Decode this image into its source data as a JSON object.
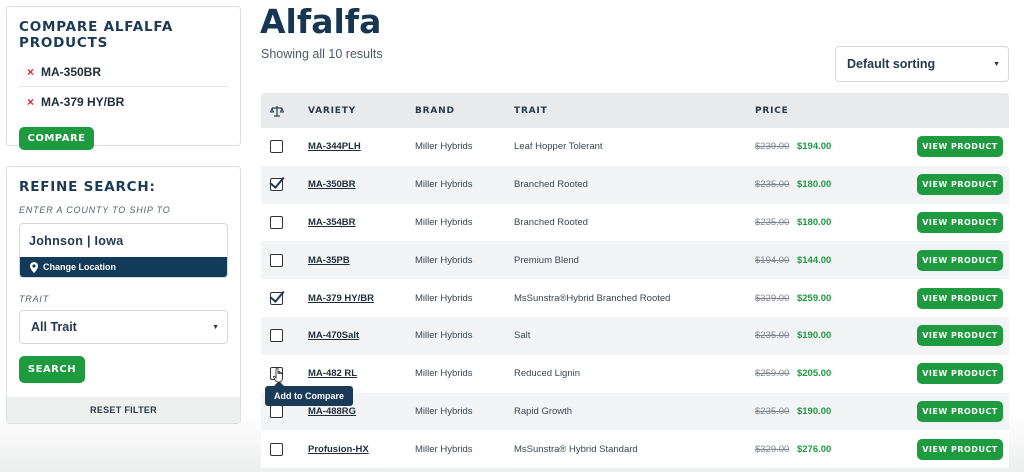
{
  "compare": {
    "title": "COMPARE ALFALFA PRODUCTS",
    "items": [
      "MA-350BR",
      "MA-379 HY/BR"
    ],
    "remove_glyph": "×",
    "button_label": "COMPARE"
  },
  "refine": {
    "title": "REFINE SEARCH:",
    "county_label": "ENTER A COUNTY TO SHIP TO",
    "county_value": "Johnson | Iowa",
    "change_location": "Change Location",
    "trait_label": "TRAIT",
    "trait_value": "All Trait",
    "search_label": "SEARCH",
    "reset_label": "RESET FILTER"
  },
  "main": {
    "title": "Alfalfa",
    "result_count": "Showing all 10 results",
    "sort_value": "Default sorting"
  },
  "table": {
    "headers": {
      "variety": "VARIETY",
      "brand": "BRAND",
      "trait": "TRAIT",
      "price": "PRICE"
    },
    "action_label": "VIEW PRODUCT",
    "rows": [
      {
        "variety": "MA-344PLH",
        "brand": "Miller Hybrids",
        "trait": "Leaf Hopper Tolerant",
        "old_price": "$239.00",
        "new_price": "$194.00",
        "checked": false
      },
      {
        "variety": "MA-350BR",
        "brand": "Miller Hybrids",
        "trait": "Branched Rooted",
        "old_price": "$235.00",
        "new_price": "$180.00",
        "checked": true
      },
      {
        "variety": "MA-354BR",
        "brand": "Miller Hybrids",
        "trait": "Branched Rooted",
        "old_price": "$235.00",
        "new_price": "$180.00",
        "checked": false
      },
      {
        "variety": "MA-35PB",
        "brand": "Miller Hybrids",
        "trait": "Premium Blend",
        "old_price": "$194.00",
        "new_price": "$144.00",
        "checked": false
      },
      {
        "variety": "MA-379 HY/BR",
        "brand": "Miller Hybrids",
        "trait": "MsSunstra®Hybrid Branched Rooted",
        "old_price": "$329.00",
        "new_price": "$259.00",
        "checked": true
      },
      {
        "variety": "MA-470Salt",
        "brand": "Miller Hybrids",
        "trait": "Salt",
        "old_price": "$235.00",
        "new_price": "$190.00",
        "checked": false
      },
      {
        "variety": "MA-482 RL",
        "brand": "Miller Hybrids",
        "trait": "Reduced Lignin",
        "old_price": "$259.00",
        "new_price": "$205.00",
        "checked": false
      },
      {
        "variety": "MA-488RG",
        "brand": "Miller Hybrids",
        "trait": "Rapid Growth",
        "old_price": "$235.00",
        "new_price": "$190.00",
        "checked": false
      },
      {
        "variety": "Profusion-HX",
        "brand": "Miller Hybrids",
        "trait": "MsSunstra® Hybrid Standard",
        "old_price": "$329.00",
        "new_price": "$276.00",
        "checked": false
      }
    ]
  },
  "tooltip": {
    "text": "Add to Compare"
  },
  "colors": {
    "green": "#1e9a3f",
    "navy": "#133a59",
    "remove": "#d9252c"
  }
}
